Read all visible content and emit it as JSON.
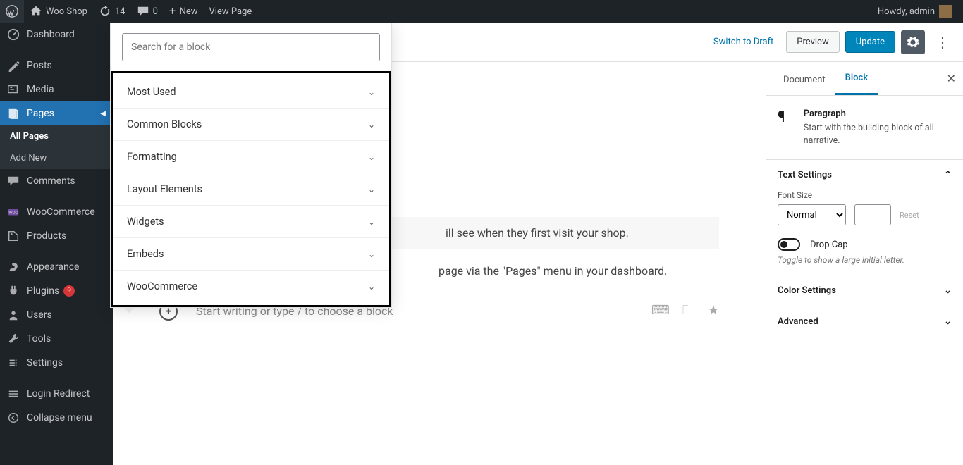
{
  "adminbar": {
    "site_name": "Woo Shop",
    "updates": "14",
    "comments": "0",
    "new": "New",
    "view_page": "View Page",
    "howdy": "Howdy, admin"
  },
  "menu": {
    "dashboard": "Dashboard",
    "posts": "Posts",
    "media": "Media",
    "pages": "Pages",
    "pages_sub_all": "All Pages",
    "pages_sub_add": "Add New",
    "comments": "Comments",
    "woocommerce": "WooCommerce",
    "products": "Products",
    "appearance": "Appearance",
    "plugins": "Plugins",
    "plugins_badge": "9",
    "users": "Users",
    "tools": "Tools",
    "settings": "Settings",
    "login_redirect": "Login Redirect",
    "collapse": "Collapse menu"
  },
  "header": {
    "switch_to_draft": "Switch to Draft",
    "preview": "Preview",
    "update": "Update"
  },
  "content": {
    "visit_text": "ill see when they first visit your shop.",
    "pages_hint_text": "page via the \"Pages\" menu in your dashboard.",
    "new_block_placeholder": "Start writing or type / to choose a block"
  },
  "sidebar": {
    "tab_document": "Document",
    "tab_block": "Block",
    "block_title": "Paragraph",
    "block_desc": "Start with the building block of all narrative.",
    "panel_text_settings": "Text Settings",
    "font_size_label": "Font Size",
    "font_size_value": "Normal",
    "reset": "Reset",
    "drop_cap": "Drop Cap",
    "drop_cap_hint": "Toggle to show a large initial letter.",
    "panel_color_settings": "Color Settings",
    "panel_advanced": "Advanced"
  },
  "inserter": {
    "search_placeholder": "Search for a block",
    "cats": {
      "most_used": "Most Used",
      "common_blocks": "Common Blocks",
      "formatting": "Formatting",
      "layout_elements": "Layout Elements",
      "widgets": "Widgets",
      "embeds": "Embeds",
      "woocommerce": "WooCommerce"
    }
  }
}
